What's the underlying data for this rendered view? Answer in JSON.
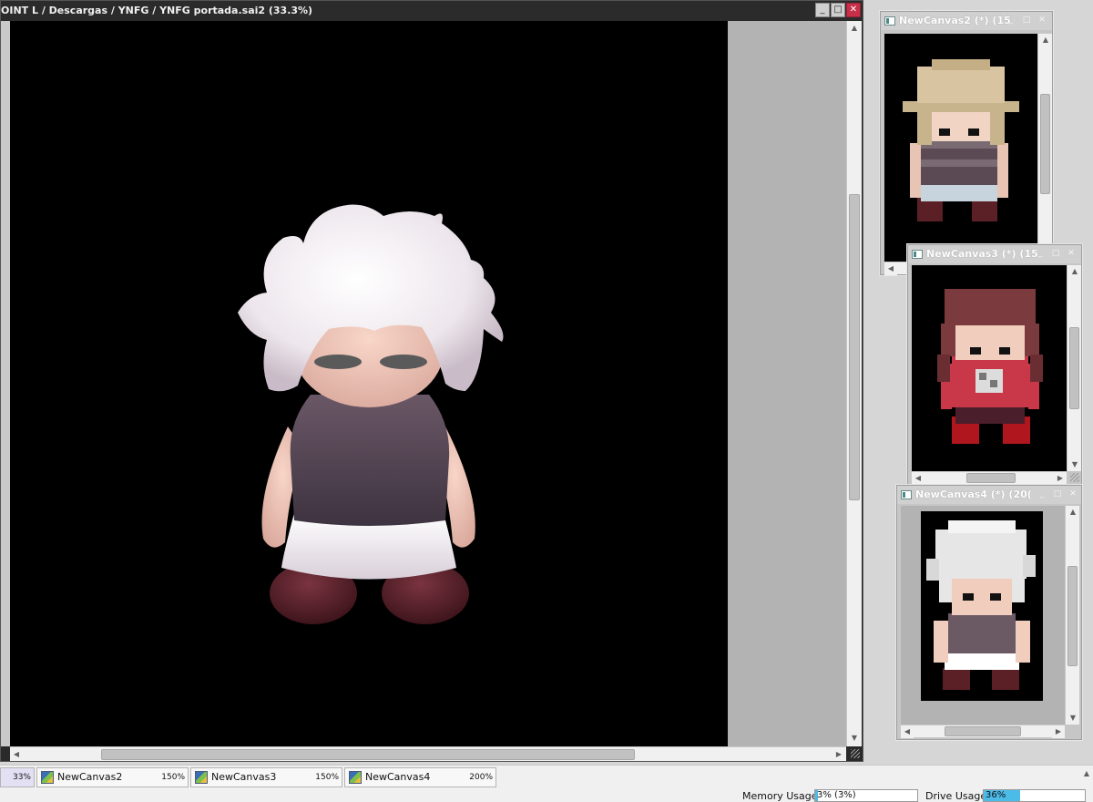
{
  "main_window": {
    "title": "OINT L / Descargas / YNFG / YNFG portada.sai2 (33.3%)",
    "buttons": {
      "minimize": "_",
      "maximize": "□",
      "close": "✕"
    }
  },
  "sub_windows": [
    {
      "title": "NewCanvas2 (*) (15",
      "min": "_",
      "max": "□",
      "close": "✕"
    },
    {
      "title": "NewCanvas3 (*) (15",
      "min": "_",
      "max": "□",
      "close": "✕"
    },
    {
      "title": "NewCanvas4 (*) (20(",
      "min": "_",
      "max": "□",
      "close": "✕"
    }
  ],
  "tabs": [
    {
      "name": "",
      "zoom": "33%"
    },
    {
      "name": "NewCanvas2",
      "zoom": "150%"
    },
    {
      "name": "NewCanvas3",
      "zoom": "150%"
    },
    {
      "name": "NewCanvas4",
      "zoom": "200%"
    }
  ],
  "status": {
    "memory_label": "Memory Usage",
    "memory_value": "3% (3%)",
    "memory_fraction": 0.03,
    "drive_label": "Drive Usage",
    "drive_value": "36%",
    "drive_fraction": 0.36
  },
  "scroll_arrows": {
    "up": "▲",
    "down": "▼",
    "left": "◀",
    "right": "▶"
  },
  "colors": {
    "canvas_bg": "#000000",
    "close_button": "#c8304a",
    "meter_fill": "#4dbbe8",
    "active_tab": "#e4e0f4"
  }
}
